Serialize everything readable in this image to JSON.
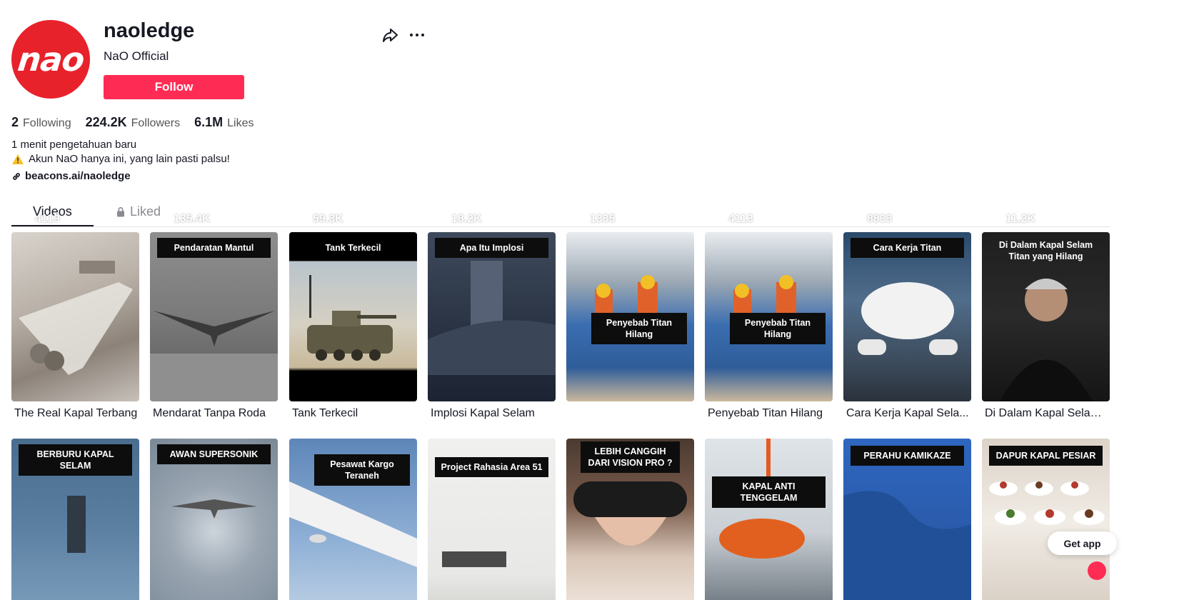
{
  "profile": {
    "avatar_text": "nao",
    "username": "naoledge",
    "nickname": "NaO Official",
    "follow_label": "Follow",
    "share_icon": "share-icon",
    "more_icon": "more-icon"
  },
  "stats": [
    {
      "value": "2",
      "label": "Following"
    },
    {
      "value": "224.2K",
      "label": "Followers"
    },
    {
      "value": "6.1M",
      "label": "Likes"
    }
  ],
  "bio": {
    "line1": "1 menit pengetahuan baru",
    "line2": "Akun NaO hanya ini, yang lain pasti palsu!",
    "link": "beacons.ai/naoledge"
  },
  "tabs": [
    {
      "label": "Videos",
      "active": true
    },
    {
      "label": "Liked",
      "active": false,
      "icon": "lock-icon"
    }
  ],
  "videos": [
    {
      "overlay": "",
      "views": "4119",
      "caption": "The Real Kapal Terbang"
    },
    {
      "overlay": "Pendaratan Mantul",
      "views": "135.4K",
      "caption": "Mendarat Tanpa Roda"
    },
    {
      "overlay": "Tank Terkecil",
      "views": "59.3K",
      "caption": "Tank Terkecil"
    },
    {
      "overlay": "Apa Itu Implosi",
      "views": "18.2K",
      "caption": "Implosi Kapal Selam"
    },
    {
      "overlay": "Penyebab Titan\nHilang",
      "views": "1335",
      "caption": ""
    },
    {
      "overlay": "Penyebab Titan\nHilang",
      "views": "4113",
      "caption": "Penyebab Titan Hilang"
    },
    {
      "overlay": "Cara Kerja Titan",
      "views": "8833",
      "caption": "Cara Kerja Kapal Sela..."
    },
    {
      "overlay": "Di Dalam Kapal Selam\nTitan yang Hilang",
      "views": "11.2K",
      "caption": "Di Dalam Kapal Selam ..."
    },
    {
      "overlay": "BERBURU KAPAL SELAM",
      "views": "",
      "caption": ""
    },
    {
      "overlay": "AWAN SUPERSONIK",
      "views": "",
      "caption": ""
    },
    {
      "overlay": "Pesawat Kargo\nTeraneh",
      "views": "",
      "caption": ""
    },
    {
      "overlay": "Project Rahasia Area 51",
      "views": "",
      "caption": ""
    },
    {
      "overlay": "LEBIH CANGGIH\nDARI VISION PRO ?",
      "views": "",
      "caption": ""
    },
    {
      "overlay": "KAPAL ANTI TENGGELAM",
      "views": "",
      "caption": ""
    },
    {
      "overlay": "PERAHU KAMIKAZE",
      "views": "",
      "caption": ""
    },
    {
      "overlay": "DAPUR KAPAL PESIAR",
      "views": "",
      "caption": ""
    }
  ],
  "get_app_label": "Get app",
  "colors": {
    "accent": "#fe2c55",
    "avatar_bg": "#e8222b",
    "text": "#161823",
    "muted": "#8a8b91"
  }
}
